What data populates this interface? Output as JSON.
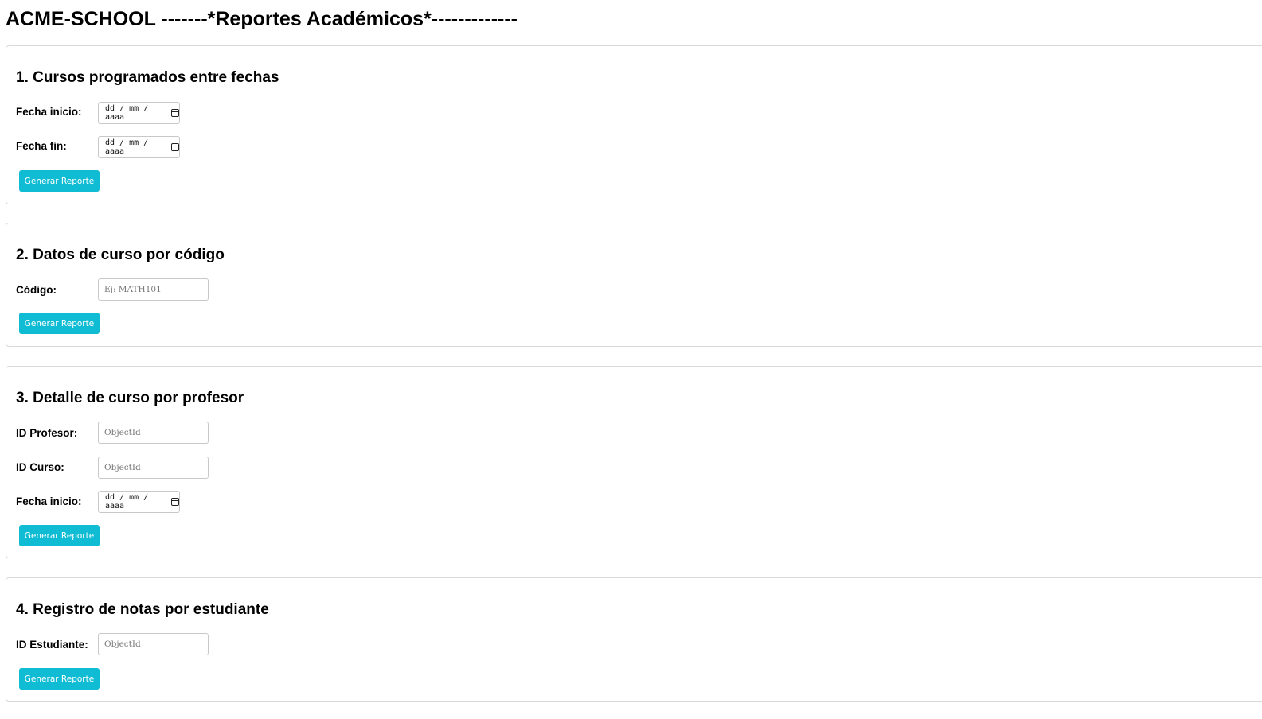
{
  "header": {
    "title": "ACME-SCHOOL -------*Reportes Académicos*-------------"
  },
  "sections": [
    {
      "title": "1. Cursos programados entre fechas",
      "fields": [
        {
          "label": "Fecha inicio:",
          "type": "date",
          "placeholder": "dd / mm / aaaa",
          "icon": "calendar-icon"
        },
        {
          "label": "Fecha fin:",
          "type": "date",
          "placeholder": "dd / mm / aaaa",
          "icon": "calendar-icon"
        }
      ],
      "button_label": "Generar Reporte"
    },
    {
      "title": "2. Datos de curso por código",
      "fields": [
        {
          "label": "Código:",
          "type": "text",
          "placeholder": "Ej: MATH101"
        }
      ],
      "button_label": "Generar Reporte"
    },
    {
      "title": "3. Detalle de curso por profesor",
      "fields": [
        {
          "label": "ID Profesor:",
          "type": "text",
          "placeholder": "ObjectId"
        },
        {
          "label": "ID Curso:",
          "type": "text",
          "placeholder": "ObjectId"
        },
        {
          "label": "Fecha inicio:",
          "type": "date",
          "placeholder": "dd / mm / aaaa",
          "icon": "calendar-icon"
        }
      ],
      "button_label": "Generar Reporte"
    },
    {
      "title": "4. Registro de notas por estudiante",
      "fields": [
        {
          "label": "ID Estudiante:",
          "type": "text",
          "placeholder": "ObjectId"
        }
      ],
      "button_label": "Generar Reporte"
    }
  ],
  "colors": {
    "button_background": "#0fbcd4",
    "button_text": "#ffffff",
    "section_border": "#d9d9d9"
  }
}
